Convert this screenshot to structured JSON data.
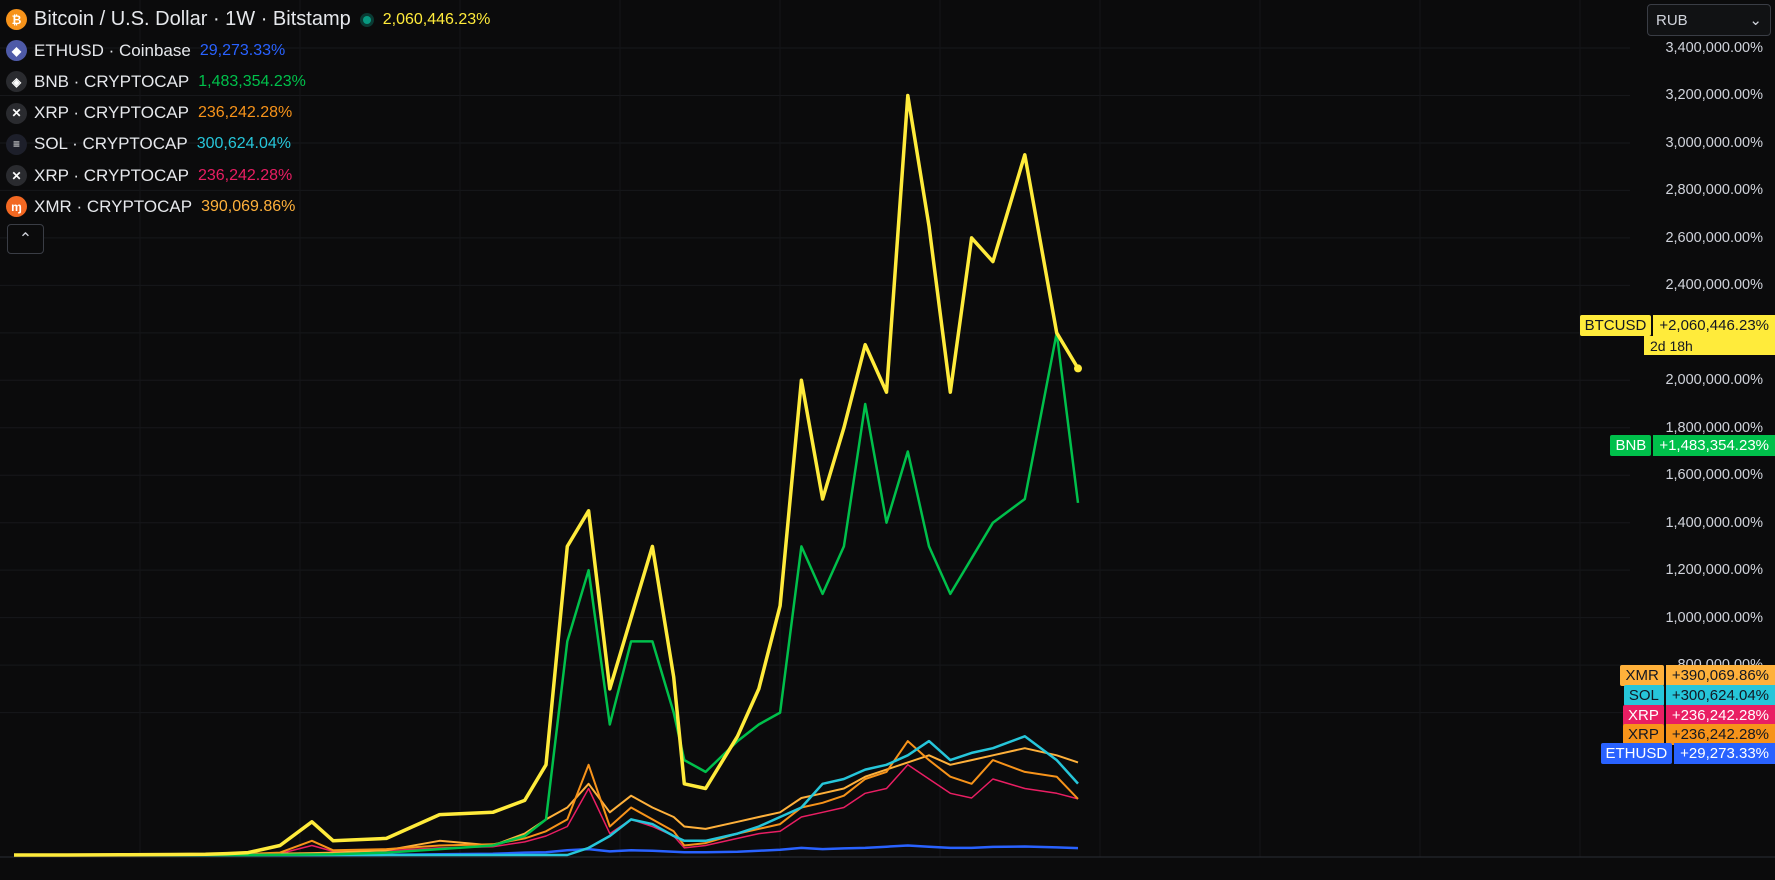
{
  "legend": {
    "main": {
      "title": "Bitcoin / U.S. Dollar · 1W · Bitstamp",
      "pct": "2,060,446.23%",
      "color": "#ffeb3b",
      "icon": "bitcoin-icon",
      "icon_color": "#f7931a",
      "glyph": "₿"
    },
    "items": [
      {
        "name": "ETHUSD · Coinbase",
        "pct": "29,273.33%",
        "color": "#2962ff",
        "icon": "ethereum-icon",
        "icon_color": "#4e5aa8",
        "glyph": "◆"
      },
      {
        "name": "BNB · CRYPTOCAP",
        "pct": "1,483,354.23%",
        "color": "#00c04b",
        "icon": "bnb-icon",
        "icon_color": "#2a2b2f",
        "glyph": "◈"
      },
      {
        "name": "XRP · CRYPTOCAP",
        "pct": "236,242.28%",
        "color": "#f7931a",
        "icon": "xrp-icon",
        "icon_color": "#2a2b2f",
        "glyph": "✕"
      },
      {
        "name": "SOL · CRYPTOCAP",
        "pct": "300,624.04%",
        "color": "#26c6da",
        "icon": "solana-icon",
        "icon_color": "#1d1f2a",
        "glyph": "≡"
      },
      {
        "name": "XRP · CRYPTOCAP",
        "pct": "236,242.28%",
        "color": "#e91e63",
        "icon": "xrp-icon",
        "icon_color": "#2a2b2f",
        "glyph": "✕"
      },
      {
        "name": "XMR · CRYPTOCAP",
        "pct": "390,069.86%",
        "color": "#ffb13b",
        "icon": "monero-icon",
        "icon_color": "#f26822",
        "glyph": "ɱ"
      }
    ],
    "collapse_icon": "chevron-up-icon"
  },
  "currency": {
    "label": "RUB",
    "icon": "chevron-down-icon"
  },
  "price_tags": [
    {
      "name": "BTCUSD",
      "value": "+2,060,446.23%",
      "sub": "2d 18h",
      "at": 2050000,
      "bg": "#ffeb3b",
      "fg": "#131722"
    },
    {
      "name": "BNB",
      "value": "+1,483,354.23%",
      "at": 1483354,
      "bg": "#00c04b",
      "fg": "#ffffff"
    },
    {
      "name": "XMR",
      "value": "+390,069.86%",
      "at": 390070,
      "bg": "#ffb13b",
      "fg": "#131722"
    },
    {
      "name": "SOL",
      "value": "+300,624.04%",
      "at": 300624,
      "bg": "#26c6da",
      "fg": "#131722"
    },
    {
      "name": "XRP",
      "value": "+236,242.28%",
      "at": 236242,
      "bg": "#e91e63",
      "fg": "#ffffff"
    },
    {
      "name": "XRP",
      "value": "+236,242.28%",
      "at": 236242,
      "bg": "#f7931a",
      "fg": "#131722"
    },
    {
      "name": "ETHUSD",
      "value": "+29,273.33%",
      "at": 29273,
      "bg": "#2962ff",
      "fg": "#ffffff"
    }
  ],
  "chart_data": {
    "type": "line",
    "ylim": [
      -40000,
      3500000
    ],
    "y_ticks": [
      600000,
      800000,
      1000000,
      1200000,
      1400000,
      1600000,
      1800000,
      2000000,
      2200000,
      2400000,
      2600000,
      2800000,
      3000000,
      3200000,
      3400000
    ],
    "y_tick_labels": [
      "600,000.00%",
      "800,000.00%",
      "1,000,000.00%",
      "1,200,000.00%",
      "1,400,000.00%",
      "1,600,000.00%",
      "1,800,000.00%",
      "2,000,000.00%",
      "2,200,000.00%",
      "2,400,000.00%",
      "2,600,000.00%",
      "2,800,000.00%",
      "3,000,000.00%",
      "3,200,000.00%",
      "3,400,000.00%"
    ],
    "x": [
      0,
      5,
      10,
      15,
      18,
      20,
      22,
      25,
      28,
      30,
      35,
      40,
      45,
      48,
      50,
      52,
      54,
      56,
      58,
      60,
      62,
      63,
      65,
      68,
      70,
      72,
      74,
      76,
      78,
      80,
      82,
      84,
      86,
      88,
      90,
      92,
      95,
      98,
      100
    ],
    "series": [
      {
        "name": "BTCUSD",
        "color": "#ffeb3b",
        "width": 3.5,
        "values": [
          0,
          0,
          1000,
          2000,
          3000,
          6000,
          10000,
          40000,
          140000,
          60000,
          70000,
          170000,
          180000,
          230000,
          380000,
          1300000,
          1450000,
          700000,
          1000000,
          1300000,
          750000,
          300000,
          280000,
          500000,
          700000,
          1050000,
          2000000,
          1500000,
          1800000,
          2150000,
          1950000,
          3200000,
          2650000,
          1950000,
          2600000,
          2500000,
          2950000,
          2200000,
          2050000
        ]
      },
      {
        "name": "BNB",
        "color": "#00c04b",
        "width": 2.5,
        "values": [
          0,
          0,
          0,
          0,
          0,
          0,
          0,
          1000,
          2000,
          3000,
          10000,
          25000,
          40000,
          80000,
          150000,
          900000,
          1200000,
          550000,
          900000,
          900000,
          600000,
          400000,
          350000,
          480000,
          550000,
          600000,
          1300000,
          1100000,
          1300000,
          1900000,
          1400000,
          1700000,
          1300000,
          1100000,
          1250000,
          1400000,
          1500000,
          2200000,
          1483354
        ]
      },
      {
        "name": "XRP",
        "color": "#f7931a",
        "width": 2,
        "values": [
          0,
          0,
          0,
          0,
          0,
          0,
          5000,
          10000,
          60000,
          20000,
          25000,
          40000,
          45000,
          70000,
          100000,
          150000,
          380000,
          120000,
          200000,
          150000,
          100000,
          40000,
          50000,
          90000,
          110000,
          130000,
          200000,
          220000,
          250000,
          320000,
          350000,
          480000,
          400000,
          330000,
          300000,
          400000,
          350000,
          330000,
          236242
        ]
      },
      {
        "name": "ETHUSD",
        "color": "#2962ff",
        "width": 2.5,
        "values": [
          0,
          0,
          0,
          0,
          0,
          0,
          0,
          0,
          0,
          0,
          1000,
          3000,
          5000,
          10000,
          12000,
          20000,
          25000,
          15000,
          20000,
          18000,
          14000,
          12000,
          12000,
          14000,
          18000,
          22000,
          30000,
          25000,
          28000,
          30000,
          35000,
          40000,
          35000,
          30000,
          30000,
          34000,
          36000,
          32000,
          29273
        ]
      },
      {
        "name": "SOL",
        "color": "#26c6da",
        "width": 2.5,
        "values": [
          0,
          0,
          0,
          0,
          0,
          0,
          0,
          0,
          0,
          0,
          0,
          0,
          0,
          0,
          0,
          0,
          30000,
          80000,
          150000,
          130000,
          80000,
          60000,
          60000,
          90000,
          120000,
          160000,
          200000,
          300000,
          320000,
          360000,
          380000,
          420000,
          480000,
          400000,
          430000,
          450000,
          500000,
          400000,
          300624
        ]
      },
      {
        "name": "XMR",
        "color": "#ffb13b",
        "width": 2,
        "values": [
          0,
          0,
          0,
          0,
          0,
          0,
          3000,
          6000,
          8000,
          10000,
          20000,
          60000,
          40000,
          90000,
          150000,
          200000,
          300000,
          180000,
          250000,
          200000,
          160000,
          120000,
          110000,
          140000,
          160000,
          180000,
          240000,
          260000,
          280000,
          330000,
          360000,
          390000,
          420000,
          380000,
          400000,
          420000,
          450000,
          420000,
          390070
        ]
      },
      {
        "name": "XRP",
        "color": "#e91e63",
        "width": 1.5,
        "values": [
          0,
          0,
          0,
          0,
          0,
          0,
          3000,
          6000,
          40000,
          15000,
          18000,
          30000,
          35000,
          55000,
          80000,
          120000,
          280000,
          90000,
          150000,
          120000,
          80000,
          30000,
          40000,
          70000,
          90000,
          100000,
          160000,
          180000,
          200000,
          260000,
          280000,
          380000,
          320000,
          260000,
          240000,
          320000,
          280000,
          260000,
          236242
        ]
      }
    ]
  }
}
